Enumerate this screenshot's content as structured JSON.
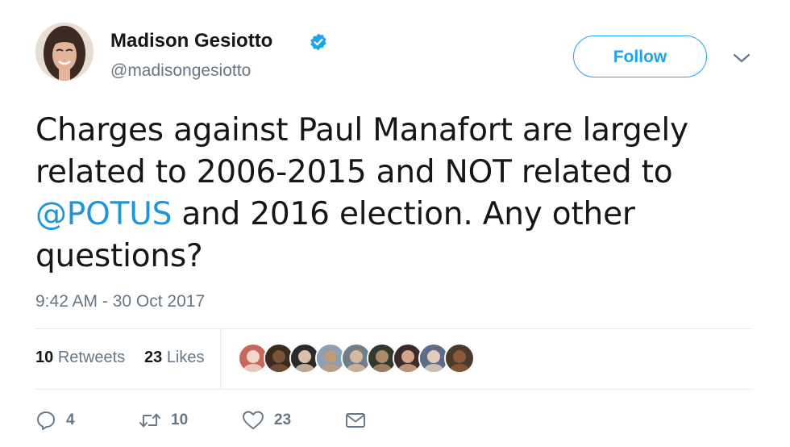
{
  "user": {
    "display_name": "Madison Gesiotto",
    "handle": "@madisongesiotto",
    "verified": true,
    "avatar_icon": "profile-photo"
  },
  "header": {
    "follow_label": "Follow",
    "more_icon": "chevron-down-icon"
  },
  "tweet": {
    "text_before": "Charges against Paul Manafort are largely related to 2006-2015 and NOT related to ",
    "mention": "@POTUS",
    "text_after": " and 2016 election. Any other questions?",
    "timestamp": "9:42 AM - 30 Oct 2017"
  },
  "stats": {
    "retweets_count": "10",
    "retweets_label": "Retweets",
    "likes_count": "23",
    "likes_label": "Likes",
    "liker_avatar_count": 9
  },
  "actions": {
    "reply_count": "4",
    "retweet_count": "10",
    "like_count": "23",
    "reply_icon": "reply-icon",
    "retweet_icon": "retweet-icon",
    "like_icon": "heart-icon",
    "dm_icon": "envelope-icon"
  },
  "colors": {
    "accent": "#1da1f2",
    "mention": "#1b95e0",
    "secondary_text": "#657786",
    "primary_text": "#14171a",
    "divider": "#e6ecf0"
  }
}
